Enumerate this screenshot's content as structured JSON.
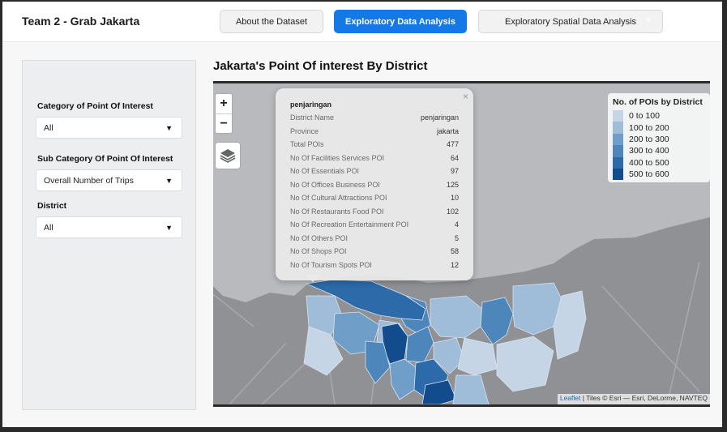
{
  "header": {
    "title": "Team 2 - Grab Jakarta",
    "tabs": [
      {
        "label": "About the Dataset",
        "active": false
      },
      {
        "label": "Exploratory Data Analysis",
        "active": true
      },
      {
        "label": "Exploratory Spatial Data Analysis",
        "active": false
      }
    ],
    "close_glyph": "×"
  },
  "sidebar": {
    "filters": [
      {
        "label": "Category of Point Of Interest",
        "value": "All"
      },
      {
        "label": "Sub Category Of Point Of Interest",
        "value": "Overall Number of Trips"
      },
      {
        "label": "District",
        "value": "All"
      }
    ],
    "caret": "▼"
  },
  "main": {
    "title": "Jakarta's Point Of interest By District"
  },
  "map": {
    "zoom_in": "+",
    "zoom_out": "−",
    "legend": {
      "title": "No. of POIs by District",
      "items": [
        {
          "label": "0 to 100",
          "color": "#c6d5e6"
        },
        {
          "label": "100 to 200",
          "color": "#9fbdd9"
        },
        {
          "label": "200 to 300",
          "color": "#6f9ec8"
        },
        {
          "label": "300 to 400",
          "color": "#4c86bb"
        },
        {
          "label": "400 to 500",
          "color": "#2c6aa9"
        },
        {
          "label": "500 to 600",
          "color": "#124c8c"
        }
      ]
    },
    "popup": {
      "title": "penjaringan",
      "close": "×",
      "rows": [
        {
          "key": "District Name",
          "value": "penjaringan"
        },
        {
          "key": "Province",
          "value": "jakarta"
        },
        {
          "key": "Total POIs",
          "value": "477"
        },
        {
          "key": "No Of Facilities Services POI",
          "value": "64"
        },
        {
          "key": "No Of Essentials POI",
          "value": "97"
        },
        {
          "key": "No Of Offices Business POI",
          "value": "125"
        },
        {
          "key": "No Of Cultural Attractions POI",
          "value": "10"
        },
        {
          "key": "No Of Restaurants Food POI",
          "value": "102"
        },
        {
          "key": "No Of Recreation Entertainment POI",
          "value": "4"
        },
        {
          "key": "No Of Others POI",
          "value": "5"
        },
        {
          "key": "No Of Shops POI",
          "value": "58"
        },
        {
          "key": "No Of Tourism Spots POI",
          "value": "12"
        }
      ]
    },
    "attribution": {
      "link": "Leaflet",
      "text": " | Tiles © Esri — Esri, DeLorme, NAVTEQ"
    }
  }
}
